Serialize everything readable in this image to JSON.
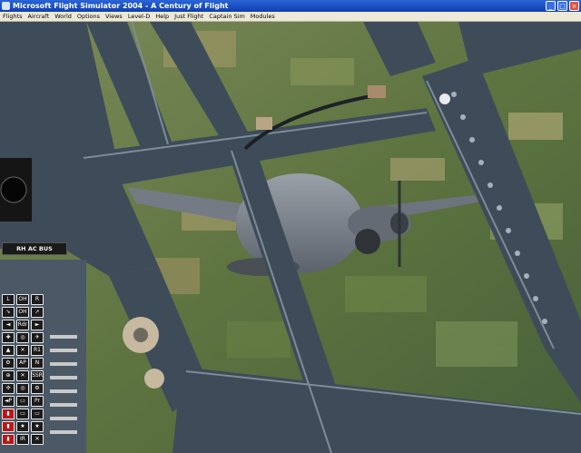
{
  "window": {
    "title": "Microsoft Flight Simulator 2004 - A Century of Flight",
    "controls": {
      "minimize": "_",
      "maximize": "□",
      "close": "×"
    }
  },
  "menu": [
    "Flights",
    "Aircraft",
    "World",
    "Options",
    "Views",
    "Level-D",
    "Help",
    "Just Flight",
    "Captain Sim",
    "Modules"
  ],
  "panel": {
    "bus_label": "RH AC BUS",
    "switch_rows": [
      [
        "L",
        "OH",
        "R"
      ],
      [
        "➘",
        "OH",
        "➚"
      ],
      [
        "◄",
        "Rdr",
        "►"
      ],
      [
        "✚",
        "◎",
        "✈"
      ],
      [
        "▲",
        "✕",
        "R1"
      ],
      [
        "⚙",
        "AP",
        "N"
      ],
      [
        "⊕",
        "✕",
        "SSR"
      ],
      [
        "✣",
        "◎",
        "⚙"
      ],
      [
        "◄P",
        "▭",
        "Pr"
      ],
      [
        "▮",
        "▭",
        "▭"
      ],
      [
        "▮",
        "★",
        "★"
      ],
      [
        "▮",
        "IR",
        "✕"
      ]
    ]
  },
  "colors": {
    "title_bar": "#0f3fb0",
    "frame": "#3e4c5a",
    "panel_red": "#b81818"
  }
}
